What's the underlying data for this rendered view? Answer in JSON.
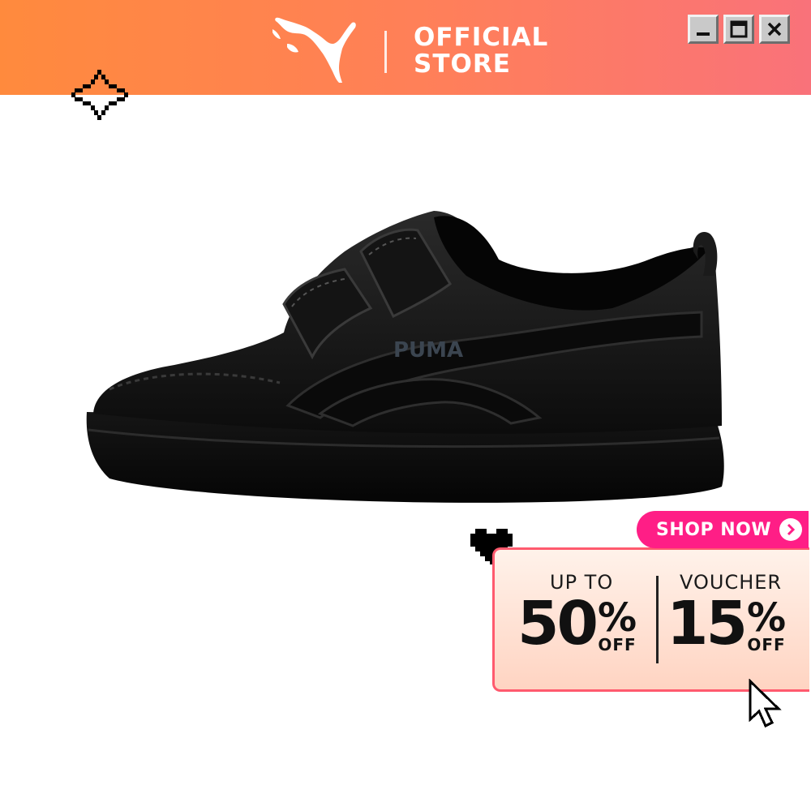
{
  "header": {
    "logo_icon": "puma-cat-logo",
    "store_line1": "OFFICIAL",
    "store_line2": "STORE",
    "gradient": [
      "#ff8a3d",
      "#f9727a"
    ]
  },
  "window_controls": {
    "icons": [
      "minimize-icon",
      "maximize-icon",
      "close-icon"
    ]
  },
  "product": {
    "image": "black-velcro-sneaker",
    "brand_mark": "PUMA"
  },
  "promo": {
    "shop_now_label": "SHOP NOW",
    "shop_now_color": "#ff1e86",
    "left": {
      "small": "UP TO",
      "big": "50",
      "pct": "%",
      "off": "OFF"
    },
    "right": {
      "small": "VOUCHER",
      "big": "15",
      "pct": "%",
      "off": "OFF"
    },
    "border_color": "#ff5a6e"
  }
}
